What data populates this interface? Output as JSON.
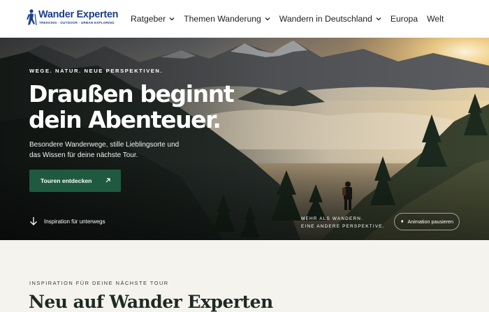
{
  "header": {
    "logo_title": "Wander Experten",
    "logo_tagline": "TREKKING · OUTDOOR · URBAN EXPLORING",
    "nav": [
      {
        "label": "Ratgeber",
        "has_dropdown": true
      },
      {
        "label": "Themen Wanderung",
        "has_dropdown": true
      },
      {
        "label": "Wandern in Deutschland",
        "has_dropdown": true
      },
      {
        "label": "Europa",
        "has_dropdown": false
      },
      {
        "label": "Welt",
        "has_dropdown": false
      }
    ]
  },
  "hero": {
    "eyebrow": "WEGE. NATUR. NEUE PERSPEKTIVEN.",
    "headline_line1": "Draußen beginnt",
    "headline_line2": "dein Abenteuer.",
    "subline_line1": "Besondere Wanderwege, stille Lieblingsorte und",
    "subline_line2": "das Wissen für deine nächste Tour.",
    "cta_label": "Touren entdecken",
    "cta_icon": "arrow-up-right-icon",
    "scroll_hint": "Inspiration für unterwegs",
    "scroll_icon": "arrow-down-icon",
    "tagline_line1": "MEHR ALS WANDERN.",
    "tagline_line2": "EINE ANDERE PERSPEKTIVE.",
    "pause_icon": "⏸",
    "pause_label": "Animation pausieren"
  },
  "section": {
    "eyebrow": "INSPIRATION FÜR DEINE NÄCHSTE TOUR",
    "title": "Neu auf Wander Experten"
  },
  "colors": {
    "brand": "#1d3f8a",
    "cta": "#1f5a40",
    "page_bg": "#f5f3ee"
  }
}
